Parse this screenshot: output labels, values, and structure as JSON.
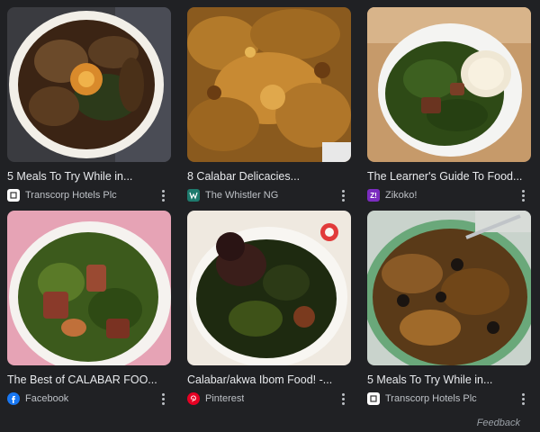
{
  "results": [
    {
      "title": "5 Meals To Try While in...",
      "source": "Transcorp Hotels Plc",
      "favicon": "transcorp-favicon",
      "image": "food-photo-platter-tripe"
    },
    {
      "title": "8 Calabar Delicacies...",
      "source": "The Whistler NG",
      "favicon": "whistler-favicon",
      "image": "food-photo-soup-assorted"
    },
    {
      "title": "The Learner's Guide To Food...",
      "source": "Zikoko!",
      "favicon": "zikoko-favicon",
      "image": "food-photo-vegetable-soup-swallow"
    },
    {
      "title": "The Best of CALABAR FOO...",
      "source": "Facebook",
      "favicon": "facebook-favicon",
      "image": "food-photo-leafy-soup-meat"
    },
    {
      "title": "Calabar/akwa Ibom Food! -...",
      "source": "Pinterest",
      "favicon": "pinterest-favicon",
      "image": "food-photo-dark-vegetable-soup"
    },
    {
      "title": "5 Meals To Try While in...",
      "source": "Transcorp Hotels Plc",
      "favicon": "transcorp-favicon",
      "image": "food-photo-periwinkle-stew"
    }
  ],
  "favicon_labels": {
    "zikoko": "Z!"
  },
  "feedback_label": "Feedback",
  "colors": {
    "background": "#202124",
    "text": "#e8eaed",
    "muted": "#bdc1c6",
    "facebook": "#1877f2",
    "pinterest": "#e60023",
    "zikoko": "#7b2cbf"
  }
}
